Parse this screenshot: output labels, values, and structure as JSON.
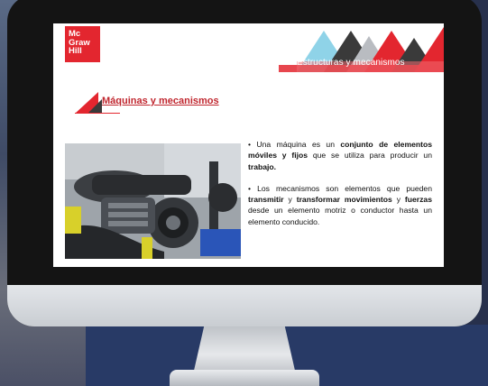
{
  "logo": {
    "line1": "Mc",
    "line2": "Graw",
    "line3": "Hill"
  },
  "header": {
    "title": "Estructuras y mecanismos"
  },
  "section": {
    "title": "Máquinas y mecanismos"
  },
  "paragraph1": {
    "p1": "• Una máquina es un ",
    "b1": "conjunto de elementos móviles y fijos",
    "p2": " que se utiliza para producir un ",
    "b2": "trabajo."
  },
  "paragraph2": {
    "p1": "• Los mecanismos son elementos que pueden ",
    "b1": "transmitir",
    "p2": " y ",
    "b2": "transformar movimientos",
    "p3": " y ",
    "b3": "fuerzas",
    "p4": " desde un elemento motriz o conductor hasta un elemento conducido."
  },
  "colors": {
    "brand_red": "#e3262f",
    "accent_cyan": "#8fd3e8",
    "dark_gray": "#3a3a3a"
  },
  "image": {
    "subject": "motorcycle-engine-photo"
  }
}
